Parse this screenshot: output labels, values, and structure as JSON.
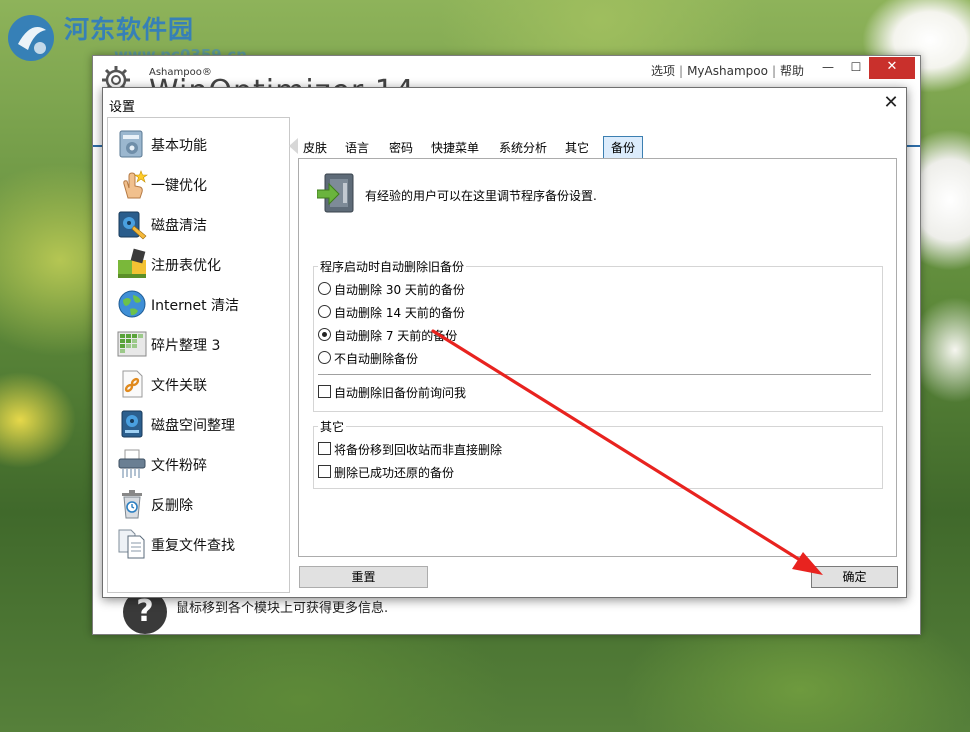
{
  "watermark": {
    "title": "河东软件园",
    "url": "www.pc0359.cn"
  },
  "app": {
    "brand": "Ashampoo®",
    "product": "WinOptimizer 14",
    "links": [
      "选项",
      "MyAshampoo",
      "帮助"
    ],
    "link_separator": "|",
    "window_buttons": {
      "minimize": "—",
      "maximize": "☐",
      "close": "✕"
    },
    "help_icon": "?",
    "hint": "鼠标移到各个模块上可获得更多信息."
  },
  "dialog": {
    "title": "设置",
    "close": "✕",
    "sidebar": [
      {
        "label": "基本功能",
        "icon": "settings-icon"
      },
      {
        "label": "一键优化",
        "icon": "one-click-icon"
      },
      {
        "label": "磁盘清洁",
        "icon": "disk-cleaner-icon"
      },
      {
        "label": "注册表优化",
        "icon": "registry-icon"
      },
      {
        "label": "Internet 清洁",
        "icon": "globe-icon"
      },
      {
        "label": "碎片整理 3",
        "icon": "defrag-icon"
      },
      {
        "label": "文件关联",
        "icon": "file-link-icon"
      },
      {
        "label": "磁盘空间整理",
        "icon": "disk-space-icon"
      },
      {
        "label": "文件粉碎",
        "icon": "shredder-icon"
      },
      {
        "label": "反删除",
        "icon": "undelete-icon"
      },
      {
        "label": "重复文件查找",
        "icon": "duplicate-files-icon"
      }
    ],
    "tabs": [
      "皮肤",
      "语言",
      "密码",
      "快捷菜单",
      "系统分析",
      "其它",
      "备份"
    ],
    "active_tab": "备份",
    "header_text": "有经验的用户可以在这里调节程序备份设置.",
    "group_auto": {
      "title": "程序启动时自动删除旧备份",
      "radios": [
        {
          "label": "自动删除 30 天前的备份",
          "checked": false
        },
        {
          "label": "自动删除 14 天前的备份",
          "checked": false
        },
        {
          "label": "自动删除 7 天前的备份",
          "checked": true
        },
        {
          "label": "不自动删除备份",
          "checked": false
        }
      ],
      "ask_checkbox": {
        "label": "自动删除旧备份前询问我",
        "checked": false
      }
    },
    "group_other": {
      "title": "其它",
      "checkboxes": [
        {
          "label": "将备份移到回收站而非直接删除",
          "checked": false
        },
        {
          "label": "删除已成功还原的备份",
          "checked": false
        }
      ]
    },
    "buttons": {
      "reset": "重置",
      "ok": "确定"
    }
  },
  "colors": {
    "accent_blue": "#2f6ea8",
    "active_tab_bg": "#dcecfc",
    "arrow_red": "#e8231f",
    "close_red": "#c9302c"
  }
}
